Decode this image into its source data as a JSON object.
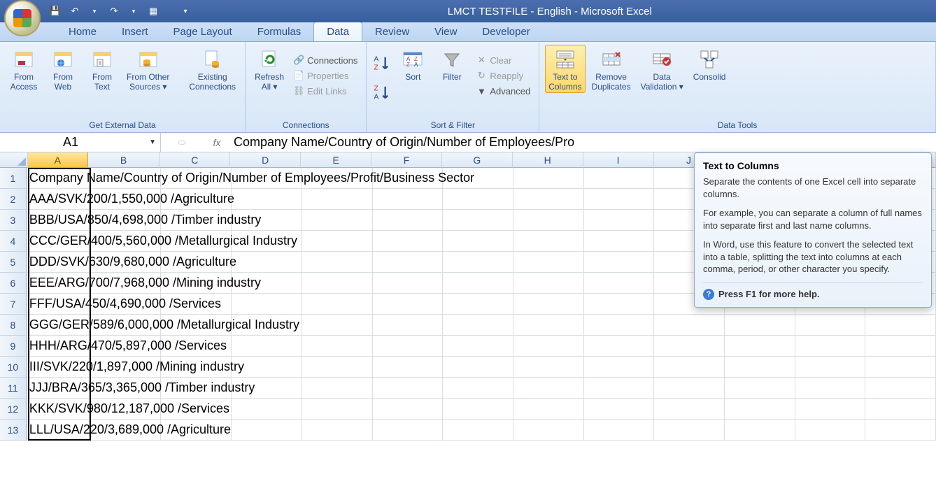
{
  "app_title": "LMCT TESTFILE - English - Microsoft Excel",
  "tabs": {
    "t0": "Home",
    "t1": "Insert",
    "t2": "Page Layout",
    "t3": "Formulas",
    "t4": "Data",
    "t5": "Review",
    "t6": "View",
    "t7": "Developer"
  },
  "ribbon": {
    "get_ext": {
      "label": "Get External Data",
      "from_access": "From\nAccess",
      "from_web": "From\nWeb",
      "from_text": "From\nText",
      "from_other": "From Other\nSources ▾",
      "existing": "Existing\nConnections"
    },
    "connections": {
      "label": "Connections",
      "refresh": "Refresh\nAll ▾",
      "conn": "Connections",
      "prop": "Properties",
      "edit": "Edit Links"
    },
    "sortfilter": {
      "label": "Sort & Filter",
      "sort": "Sort",
      "filter": "Filter",
      "clear": "Clear",
      "reapply": "Reapply",
      "advanced": "Advanced"
    },
    "datatools": {
      "label": "Data Tools",
      "ttc": "Text to\nColumns",
      "dup": "Remove\nDuplicates",
      "val": "Data\nValidation ▾",
      "cons": "Consolid"
    }
  },
  "namebox": "A1",
  "formula": "Company Name/Country of Origin/Number of Employees/Pro",
  "columns": [
    "A",
    "B",
    "C",
    "D",
    "E",
    "F",
    "G",
    "H",
    "I",
    "J",
    "K",
    "L",
    "M"
  ],
  "colwidths": [
    "wA",
    "wB",
    "wC",
    "wD",
    "wE",
    "wF",
    "wG",
    "wH",
    "wI",
    "wJ",
    "wK",
    "wL",
    "wM"
  ],
  "rows": [
    {
      "n": "1",
      "a": "Company Name/Country of Origin/Number of Employees/Profit/Business Sector"
    },
    {
      "n": "2",
      "a": "AAA/SVK/200/1,550,000 /Agriculture"
    },
    {
      "n": "3",
      "a": "BBB/USA/850/4,698,000 /Timber industry"
    },
    {
      "n": "4",
      "a": "CCC/GER/400/5,560,000 /Metallurgical Industry"
    },
    {
      "n": "5",
      "a": "DDD/SVK/630/9,680,000 /Agriculture"
    },
    {
      "n": "6",
      "a": "EEE/ARG/700/7,968,000 /Mining industry"
    },
    {
      "n": "7",
      "a": "FFF/USA/450/4,690,000 /Services"
    },
    {
      "n": "8",
      "a": "GGG/GER/589/6,000,000 /Metallurgical Industry"
    },
    {
      "n": "9",
      "a": "HHH/ARG/470/5,897,000 /Services"
    },
    {
      "n": "10",
      "a": "III/SVK/220/1,897,000 /Mining industry"
    },
    {
      "n": "11",
      "a": "JJJ/BRA/365/3,365,000 /Timber industry"
    },
    {
      "n": "12",
      "a": "KKK/SVK/980/12,187,000 /Services"
    },
    {
      "n": "13",
      "a": "LLL/USA/220/3,689,000 /Agriculture"
    }
  ],
  "tooltip": {
    "title": "Text to Columns",
    "p1": "Separate the contents of one Excel cell into separate columns.",
    "p2": "For example, you can separate a column of full names into separate first and last name columns.",
    "p3": "In Word, use this feature to convert the selected text into a table, splitting the text into columns at each comma, period, or other character you specify.",
    "help": "Press F1 for more help."
  }
}
